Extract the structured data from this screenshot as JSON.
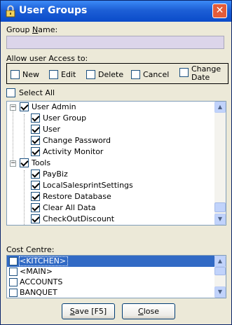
{
  "window": {
    "title": "User Groups",
    "close_glyph": "✕"
  },
  "group_name": {
    "label_pre": "Group ",
    "label_u": "N",
    "label_post": "ame:",
    "value": ""
  },
  "access": {
    "label": "Allow user Access to:",
    "options": [
      {
        "label": "New",
        "checked": false
      },
      {
        "label": "Edit",
        "checked": false
      },
      {
        "label": "Delete",
        "checked": false
      },
      {
        "label": "Cancel",
        "checked": false
      },
      {
        "label_line1": "Change",
        "label_line2": "Date",
        "checked": false
      }
    ]
  },
  "select_all": {
    "label": "Select All",
    "checked": false
  },
  "tree": {
    "rows": [
      {
        "label": "User Admin",
        "level": 0,
        "expander": "−",
        "checked": true
      },
      {
        "label": "User Group",
        "level": 1,
        "checked": true
      },
      {
        "label": "User",
        "level": 1,
        "checked": true
      },
      {
        "label": "Change Password",
        "level": 1,
        "checked": true
      },
      {
        "label": "Activity Monitor",
        "level": 1,
        "checked": true
      },
      {
        "label": "Tools",
        "level": 0,
        "expander": "−",
        "checked": true
      },
      {
        "label": "PayBiz",
        "level": 1,
        "checked": true
      },
      {
        "label": "LocalSalesprintSettings",
        "level": 1,
        "checked": true
      },
      {
        "label": "Restore Database",
        "level": 1,
        "checked": true
      },
      {
        "label": "Clear All Data",
        "level": 1,
        "checked": true
      },
      {
        "label": "CheckOutDiscount",
        "level": 1,
        "checked": true
      }
    ]
  },
  "cost_centre": {
    "label": "Cost Centre:",
    "items": [
      {
        "label": "<KITCHEN>",
        "checked": false,
        "selected": true
      },
      {
        "label": "<MAIN>",
        "checked": false,
        "selected": false
      },
      {
        "label": "ACCOUNTS",
        "checked": false,
        "selected": false
      },
      {
        "label": "BANQUET",
        "checked": false,
        "selected": false
      }
    ]
  },
  "buttons": {
    "save": {
      "label_u": "S",
      "label_rest": "ave [F5]"
    },
    "close": {
      "label_u": "C",
      "label_rest": "lose"
    }
  },
  "scroll_glyphs": {
    "up": "▲",
    "down": "▼"
  }
}
